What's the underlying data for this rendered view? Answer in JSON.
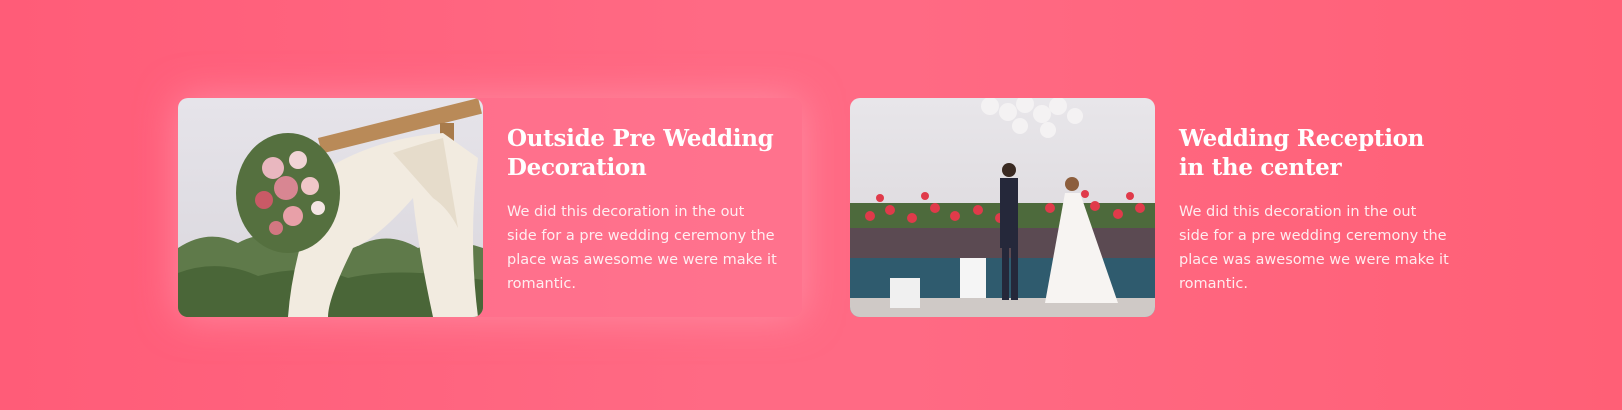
{
  "cards": [
    {
      "title": "Outside Pre Wedding Decoration",
      "description": "We did this decoration in the out side for a pre wedding ceremony the place was awesome we were make it romantic.",
      "image": "wedding-arch-bouquet"
    },
    {
      "title": "Wedding Reception in the center",
      "description": "We did this decoration in the out side for a pre wedding ceremony the place was awesome we were make it romantic.",
      "image": "couple-balloons-pool"
    }
  ],
  "colors": {
    "background": "#ff6a84",
    "card_highlight": "#ff7896",
    "text": "#ffffff"
  }
}
